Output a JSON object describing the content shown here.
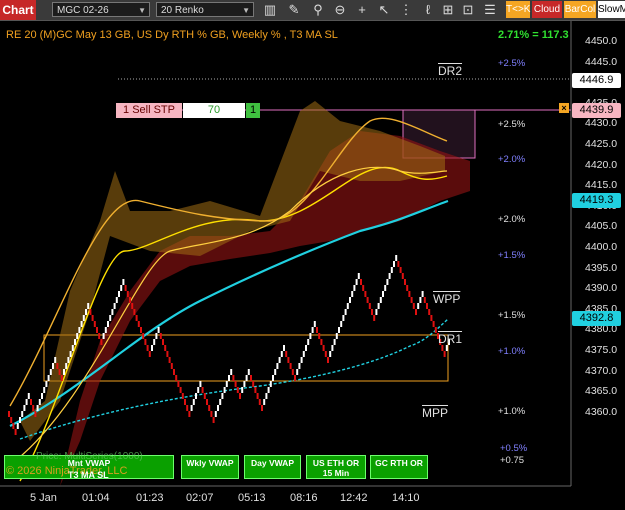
{
  "toolbar": {
    "title": "Chart",
    "instrument": "MGC 02-26",
    "period": "20 Renko",
    "buttons": [
      {
        "label": "T<>K",
        "bg": "#f5a623",
        "color": "#fff"
      },
      {
        "label": "Cloud",
        "bg": "#c62828",
        "color": "#fff"
      },
      {
        "label": "BarCol",
        "bg": "#f5a623",
        "color": "#fff"
      },
      {
        "label": "SlowM",
        "bg": "#ffffff",
        "color": "#000"
      }
    ]
  },
  "header": {
    "description": "RE 20  (M)GC May 13 GB, US Dy RTH % GB, Weekly % , T3 MA SL",
    "change": "2.71% = 117.3"
  },
  "price_axis": [
    "4450.0",
    "4445.0",
    "4440.0",
    "4435.0",
    "4430.0",
    "4425.0",
    "4420.0",
    "4415.0",
    "4410.0",
    "4405.0",
    "4400.0",
    "4395.0",
    "4390.0",
    "4385.0",
    "4380.0",
    "4375.0",
    "4370.0",
    "4365.0",
    "4360.0"
  ],
  "price_tags": {
    "last": "4446.9",
    "order": "4439.9",
    "cyan_upper": "4419.3",
    "cyan_lower": "4392.8"
  },
  "time_axis": [
    "5 Jan",
    "01:04",
    "01:23",
    "02:07",
    "05:13",
    "08:16",
    "12:42",
    "14:10"
  ],
  "order": {
    "label": "1 Sell STP",
    "qty": "70",
    "count": "1"
  },
  "level_labels": {
    "dr2": "DR2",
    "dr1": "DR1",
    "wpp": "WPP",
    "mpp": "MPP"
  },
  "pct_labels": [
    {
      "text": "+2.5%",
      "color": "#8080ff"
    },
    {
      "text": "+2.5%",
      "color": "#e0e0e0"
    },
    {
      "text": "+2.0%",
      "color": "#8080ff"
    },
    {
      "text": "+2.0%",
      "color": "#e0e0e0"
    },
    {
      "text": "+1.5%",
      "color": "#8080ff"
    },
    {
      "text": "+1.5%",
      "color": "#e0e0e0"
    },
    {
      "text": "+1.0%",
      "color": "#8080ff"
    },
    {
      "text": "+1.0%",
      "color": "#e0e0e0"
    },
    {
      "text": "+0.5%",
      "color": "#8080ff"
    },
    {
      "text": "+0.75",
      "color": "#e0e0e0"
    }
  ],
  "indicator_buttons": [
    {
      "label": "Mnt VWAP",
      "sub": "T3 MA SL"
    },
    {
      "label": "Wkly VWAP",
      "sub": ""
    },
    {
      "label": "Day VWAP",
      "sub": ""
    },
    {
      "label": "US ETH OR 15 Min",
      "sub": ""
    },
    {
      "label": "GC RTH OR",
      "sub": ""
    }
  ],
  "overlay_text": {
    "tooltip": "Price: MultiSeries(1000)",
    "copyright": "© 2026 NinjaTrader, LLC"
  },
  "colors": {
    "up_bar": "#ffffff",
    "down_bar": "#e01010",
    "cloud": "#c08020",
    "cyan": "#20d0e0",
    "order_line": "#e070c0"
  }
}
